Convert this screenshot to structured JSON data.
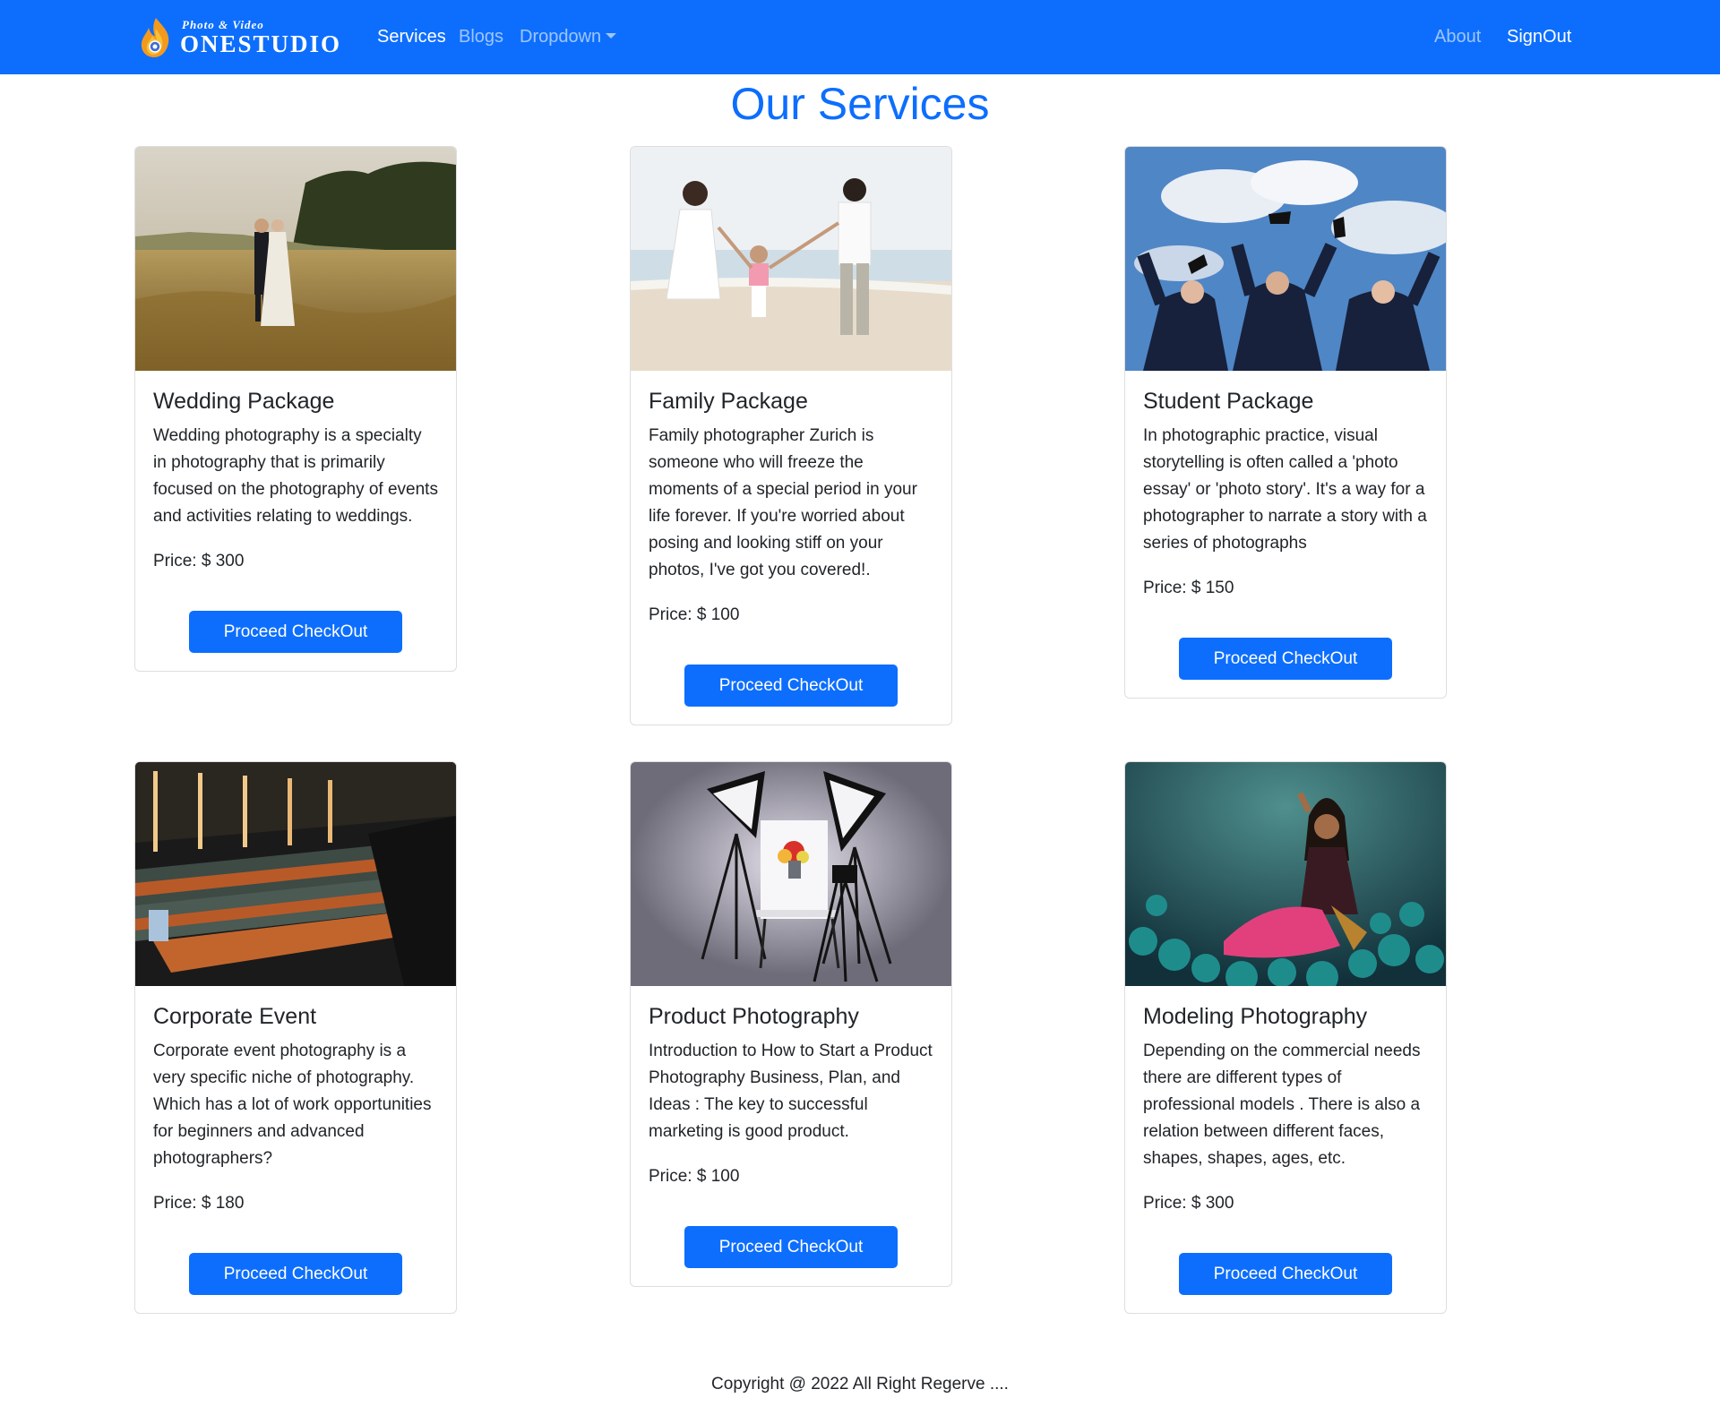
{
  "navbar": {
    "brand_sub": "Photo & Video",
    "brand_name": "ONESTUDIO",
    "brand_icon": "flame-camera-logo",
    "links": [
      {
        "label": "Services",
        "active": true
      },
      {
        "label": "Blogs",
        "active": false
      },
      {
        "label": "Dropdown",
        "active": false,
        "has_caret": true
      }
    ],
    "right_links": [
      {
        "label": "About",
        "active": false
      },
      {
        "label": "SignOut",
        "active": true
      }
    ],
    "bg_color": "#0d6efd"
  },
  "page": {
    "title": "Our Services",
    "accent_color": "#0d6efd"
  },
  "services": [
    {
      "title": "Wedding Package",
      "description": "Wedding photography is a specialty in photography that is primarily focused on the photography of events and activities relating to weddings.",
      "price": "Price: $ 300",
      "button": "Proceed CheckOut",
      "image": "wedding-couple-field-photo"
    },
    {
      "title": "Family Package",
      "description": "Family photographer Zurich is someone who will freeze the moments of a special period in your life forever. If you're worried about posing and looking stiff on your photos, I've got you covered!.",
      "price": "Price: $ 100",
      "button": "Proceed CheckOut",
      "image": "family-beach-photo"
    },
    {
      "title": "Student Package",
      "description": "In photographic practice, visual storytelling is often called a 'photo essay' or 'photo story'. It's a way for a photographer to narrate a story with a series of photographs",
      "price": "Price: $ 150",
      "button": "Proceed CheckOut",
      "image": "graduates-cap-toss-photo"
    },
    {
      "title": "Corporate Event",
      "description": "Corporate event photography is a very specific niche of photography. Which has a lot of work opportunities for beginners and advanced photographers?",
      "price": "Price: $ 180",
      "button": "Proceed CheckOut",
      "image": "auditorium-audience-photo"
    },
    {
      "title": "Product Photography",
      "description": "Introduction to How to Start a Product Photography Business, Plan, and Ideas : The key to successful marketing is good product.",
      "price": "Price: $ 100",
      "button": "Proceed CheckOut",
      "image": "product-studio-setup-photo"
    },
    {
      "title": "Modeling Photography",
      "description": "Depending on the commercial needs there are different types of professional models . There is also a relation between different faces, shapes, shapes, ages, etc.",
      "price": "Price: $ 300",
      "button": "Proceed CheckOut",
      "image": "model-in-flowers-photo"
    }
  ],
  "footer": {
    "text": "Copyright @ 2022 All Right Regerve ...."
  }
}
